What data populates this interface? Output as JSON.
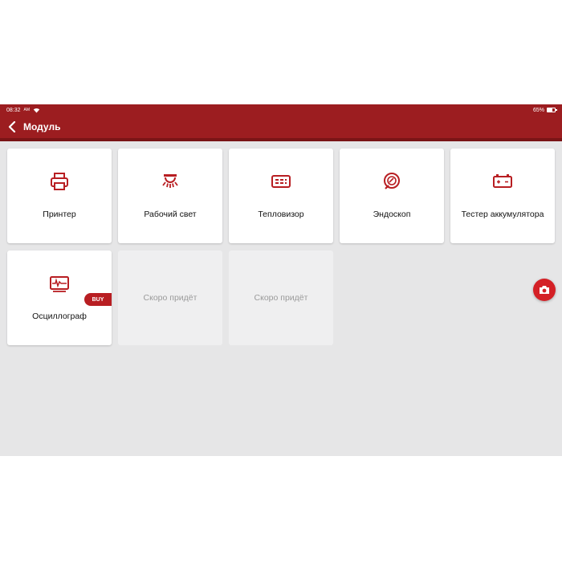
{
  "status_bar": {
    "time": "08:32",
    "ampm": "AM",
    "battery": "65%",
    "battery_level": 0.65
  },
  "header": {
    "title": "Модуль"
  },
  "modules": [
    {
      "label": "Принтер",
      "icon": "printer-icon"
    },
    {
      "label": "Рабочий свет",
      "icon": "work-light-icon"
    },
    {
      "label": "Тепловизор",
      "icon": "thermal-imager-icon"
    },
    {
      "label": "Эндоскоп",
      "icon": "endoscope-icon"
    },
    {
      "label": "Тестер аккумулятора",
      "icon": "battery-tester-icon"
    },
    {
      "label": "Осциллограф",
      "icon": "oscilloscope-icon",
      "badge": "BUY"
    },
    {
      "label": "Скоро придёт"
    },
    {
      "label": "Скоро придёт"
    }
  ],
  "fab": {
    "icon": "camera-icon"
  },
  "colors": {
    "brand": "#9c1d20",
    "accent": "#d42026",
    "background": "#e6e6e7"
  }
}
